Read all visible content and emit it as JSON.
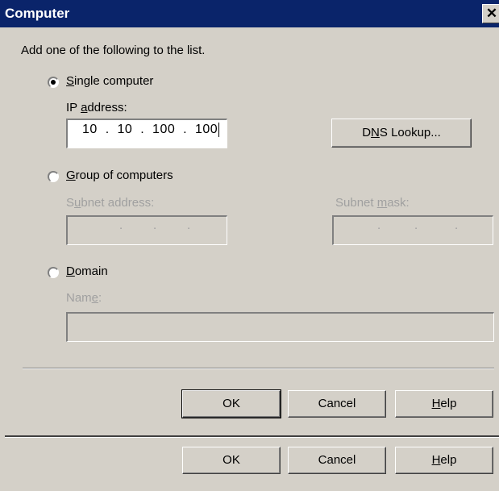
{
  "window": {
    "title": "Computer",
    "close_glyph": "✕"
  },
  "dialog": {
    "instruction": "Add one of the following to the list.",
    "single_computer": {
      "label_prefix": "",
      "label_mnemonic": "S",
      "label_rest": "ingle computer",
      "selected": true,
      "ip_label_prefix": "IP ",
      "ip_label_mnemonic": "a",
      "ip_label_rest": "ddress:",
      "ip_value": "10  .  10  .  100  .  100",
      "dns_button_prefix": "D",
      "dns_button_mnemonic": "N",
      "dns_button_rest": "S Lookup..."
    },
    "group_of_computers": {
      "label_mnemonic": "G",
      "label_rest": "roup of computers",
      "selected": false,
      "subnet_address_prefix": "S",
      "subnet_address_mnemonic": "u",
      "subnet_address_rest": "bnet address:",
      "subnet_mask_prefix": "Subnet ",
      "subnet_mask_mnemonic": "m",
      "subnet_mask_rest": "ask:",
      "empty_ip_dots": "."
    },
    "domain": {
      "label_mnemonic": "D",
      "label_rest": "omain",
      "selected": false,
      "name_prefix": "Nam",
      "name_mnemonic": "e",
      "name_rest": ":"
    },
    "buttons": {
      "ok": "OK",
      "cancel": "Cancel",
      "help_mnemonic": "H",
      "help_rest": "elp"
    }
  },
  "outer_buttons": {
    "ok": "OK",
    "cancel": "Cancel",
    "help_mnemonic": "H",
    "help_rest": "elp"
  },
  "colors": {
    "title_bar": "#0a246a",
    "dialog_face": "#d4d0c8",
    "disabled_text": "#a0a0a0"
  }
}
